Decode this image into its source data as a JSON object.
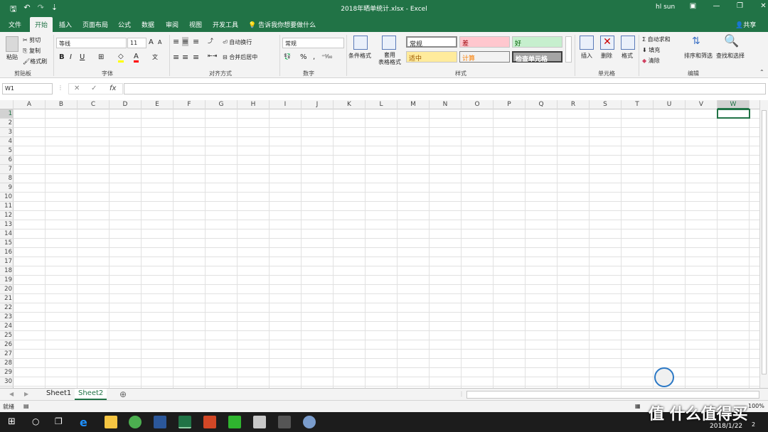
{
  "window": {
    "title": "2018年晒单统计.xlsx  -  Excel",
    "user": "hl sun",
    "qat_save": "🖫",
    "qat_undo": "↶",
    "qat_redo": "↷",
    "qat_more": "⇣"
  },
  "tabs": [
    "文件",
    "开始",
    "插入",
    "页面布局",
    "公式",
    "数据",
    "审阅",
    "视图",
    "开发工具"
  ],
  "tell_me": "告诉我你想要做什么",
  "share": "共享",
  "ribbon": {
    "clipboard": {
      "paste": "粘贴",
      "cut": "剪切",
      "copy": "复制",
      "format_painter": "格式刷",
      "label": "剪贴板"
    },
    "font": {
      "name": "等线",
      "size": "11",
      "bold": "B",
      "italic": "I",
      "underline": "U",
      "grow": "A",
      "shrink": "A",
      "label": "字体"
    },
    "align": {
      "wrap": "自动换行",
      "merge": "合并后居中",
      "label": "对齐方式"
    },
    "number": {
      "format": "常规",
      "percent": "%",
      "comma": ",",
      "label": "数字"
    },
    "styles": {
      "conditional": "条件格式",
      "table": "套用\n表格格式",
      "normal": "常规",
      "bad": "差",
      "good": "好",
      "neutral": "适中",
      "calc": "计算",
      "check": "检查单元格",
      "label": "样式"
    },
    "cells": {
      "insert": "插入",
      "delete": "删除",
      "format": "格式",
      "label": "单元格"
    },
    "editing": {
      "autosum": "自动求和",
      "fill": "填充",
      "clear": "清除",
      "sort": "排序和筛选",
      "find": "查找和选择",
      "label": "编辑"
    }
  },
  "formula_bar": {
    "name_box": "W1",
    "cancel": "✕",
    "enter": "✓",
    "fx": "fx",
    "value": ""
  },
  "columns": [
    "A",
    "B",
    "C",
    "D",
    "E",
    "F",
    "G",
    "H",
    "I",
    "J",
    "K",
    "L",
    "M",
    "N",
    "O",
    "P",
    "Q",
    "R",
    "S",
    "T",
    "U",
    "V",
    "W"
  ],
  "rows": [
    "1",
    "2",
    "3",
    "4",
    "5",
    "6",
    "7",
    "8",
    "9",
    "10",
    "11",
    "12",
    "13",
    "14",
    "15",
    "16",
    "17",
    "18",
    "19",
    "20",
    "21",
    "22",
    "23",
    "24",
    "25",
    "26",
    "27",
    "28",
    "29",
    "30"
  ],
  "selected_column": "W",
  "sheets": [
    "Sheet1",
    "Sheet2"
  ],
  "active_sheet": "Sheet2",
  "status": {
    "ready": "就绪",
    "zoom": "100%"
  },
  "taskbar": {
    "date": "2018/1/22",
    "badge": "2"
  },
  "watermark": "值 什么值得买",
  "colors": {
    "excel_green": "#217346",
    "taskbar": "#1c1c1c"
  }
}
